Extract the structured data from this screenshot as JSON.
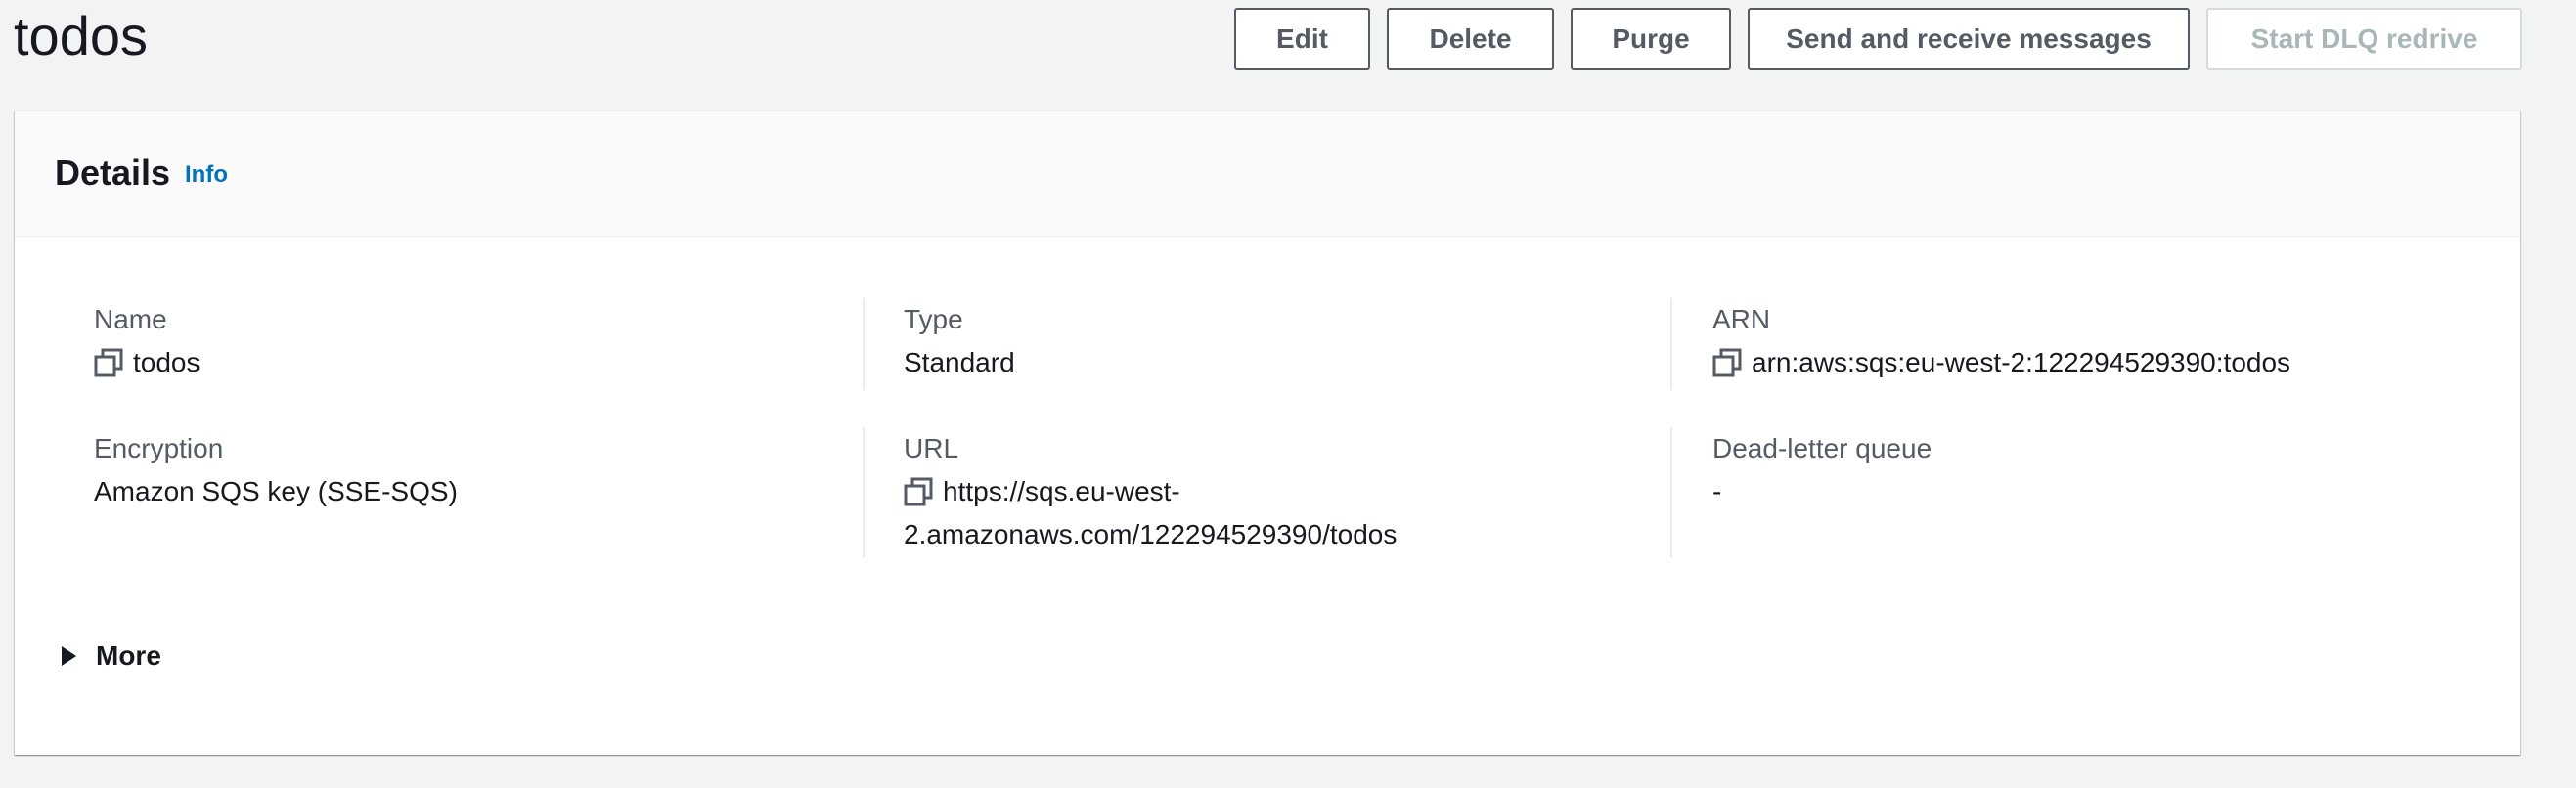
{
  "page": {
    "title": "todos"
  },
  "actions": {
    "edit": "Edit",
    "delete": "Delete",
    "purge": "Purge",
    "send_receive": "Send and receive messages",
    "start_dlq_redrive": "Start DLQ redrive"
  },
  "details": {
    "title": "Details",
    "info_link": "Info",
    "fields": {
      "name": {
        "label": "Name",
        "value": "todos"
      },
      "type": {
        "label": "Type",
        "value": "Standard"
      },
      "arn": {
        "label": "ARN",
        "value": "arn:aws:sqs:eu-west-2:122294529390:todos"
      },
      "encryption": {
        "label": "Encryption",
        "value": "Amazon SQS key (SSE-SQS)"
      },
      "url": {
        "label": "URL",
        "value_line1": "https://sqs.eu-west-",
        "value_line2": "2.amazonaws.com/122294529390/todos"
      },
      "dlq": {
        "label": "Dead-letter queue",
        "value": "-"
      }
    },
    "more_label": "More"
  },
  "colors": {
    "accent_link": "#0073bb",
    "disabled_text": "#aab7b8",
    "button_border": "#545b64"
  },
  "icons": {
    "copy": "copy-icon",
    "expand": "caret-right-icon"
  }
}
